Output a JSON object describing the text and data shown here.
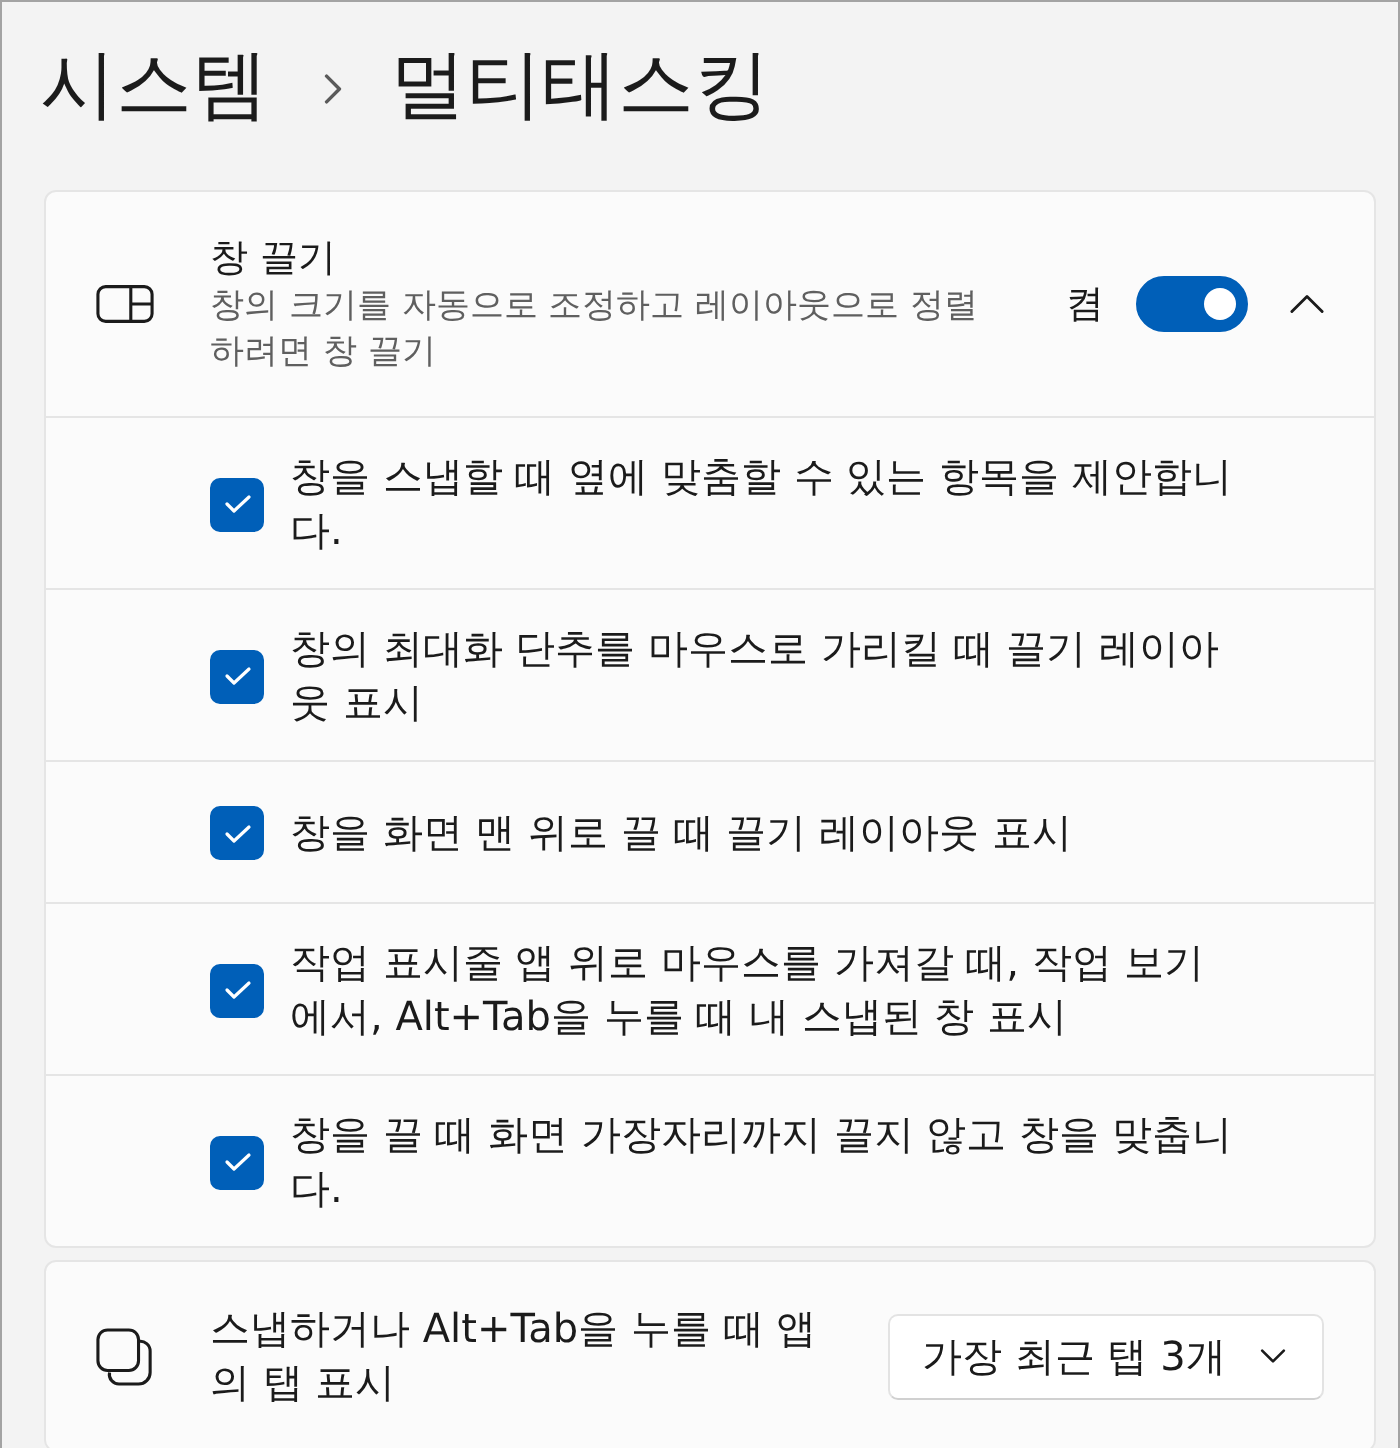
{
  "breadcrumb": {
    "parent": "시스템",
    "current": "멀티태스킹"
  },
  "snap_windows": {
    "title": "창 끌기",
    "description": "창의 크기를 자동으로 조정하고 레이아웃으로 정렬하려면 창 끌기",
    "toggle": {
      "label": "켬",
      "on": true
    },
    "expanded": true,
    "options": [
      {
        "label": "창을 스냅할 때 옆에 맞춤할 수 있는 항목을 제안합니다.",
        "checked": true
      },
      {
        "label": "창의 최대화 단추를 마우스로 가리킬 때 끌기 레이아웃 표시",
        "checked": true
      },
      {
        "label": "창을 화면 맨 위로 끌 때 끌기 레이아웃 표시",
        "checked": true
      },
      {
        "label": "작업 표시줄 앱 위로 마우스를 가져갈 때, 작업 보기에서, Alt+Tab을 누를 때 내 스냅된 창 표시",
        "checked": true
      },
      {
        "label": "창을 끌 때 화면 가장자리까지 끌지 않고 창을 맞춥니다.",
        "checked": true
      }
    ]
  },
  "snap_tabs": {
    "label": "스냅하거나 Alt+Tab을 누를 때 앱의 탭 표시",
    "dropdown": {
      "value": "가장 최근 탭 3개"
    }
  }
}
